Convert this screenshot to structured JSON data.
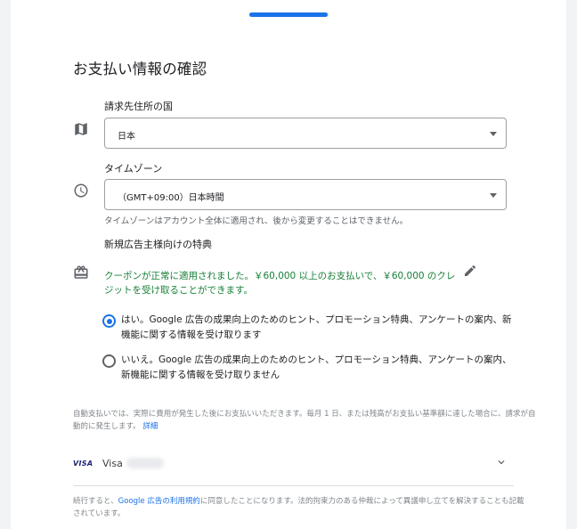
{
  "progress": {
    "fraction": 0.98
  },
  "page_title": "お支払い情報の確認",
  "country": {
    "label": "請求先住所の国",
    "value": "日本",
    "icon": "map-icon"
  },
  "timezone": {
    "label": "タイムゾーン",
    "value": "（GMT+09:00）日本時間",
    "helper": "タイムゾーンはアカウント全体に適用され、後から変更することはできません。",
    "icon": "clock-icon"
  },
  "promo": {
    "label": "新規広告主様向けの特典",
    "icon": "gift-icon",
    "coupon_text": "クーポンが正常に適用されました。￥60,000 以上のお支払いで、￥60,000 のクレジットを受け取ることができます。",
    "coupon_color": "#188038",
    "edit_icon": "pencil-icon"
  },
  "options": {
    "yes": "はい。Google 広告の成果向上のためのヒント、プロモーション特典、アンケートの案内、新機能に関する情報を受け取ります",
    "no": "いいえ。Google 広告の成果向上のためのヒント、プロモーション特典、アンケートの案内、新機能に関する情報を受け取りません",
    "selected": "yes"
  },
  "autopay": {
    "text": "自動支払いでは、実際に費用が発生した後にお支払いいただきます。毎月 1 日、または残高がお支払い基準額に達した場合に、請求が自動的に発生します。",
    "link": "詳細"
  },
  "payment": {
    "brand_logo": "VISA",
    "name": "Visa",
    "expand_icon": "chevron-down-icon"
  },
  "terms": {
    "prefix": "続行すると、",
    "link": "Google 広告の利用規約",
    "suffix": "に同意したことになります。法的拘束力のある仲裁によって異議申し立てを解決することも記載されています。"
  },
  "colors": {
    "accent": "#1a73e8",
    "success": "#188038"
  }
}
